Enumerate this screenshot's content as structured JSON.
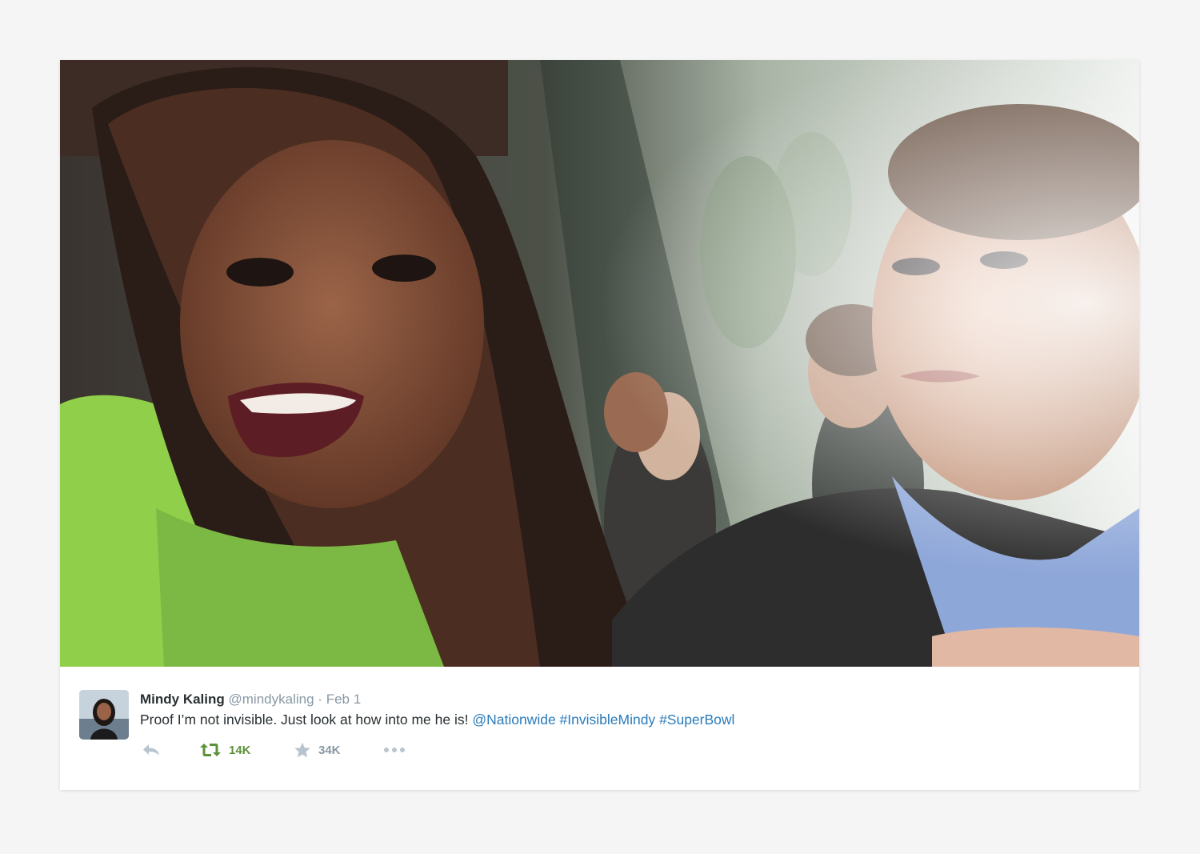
{
  "tweet": {
    "author_name": "Mindy Kaling",
    "handle": "@mindykaling",
    "separator": "·",
    "date": "Feb 1",
    "text_plain": "Proof I’m not invisible. Just look at how into me he is! ",
    "mentions": [
      "@Nationwide",
      "#InvisibleMindy",
      "#SuperBowl"
    ]
  },
  "actions": {
    "retweet_count": "14K",
    "favorite_count": "34K"
  },
  "icons": {
    "reply": "reply-icon",
    "retweet": "retweet-icon",
    "favorite": "star-icon",
    "more": "more-dots-icon"
  },
  "colors": {
    "page_background": "#f6f5f5",
    "card_background": "#ffffff",
    "text_primary": "#292f33",
    "text_secondary": "#8899a6",
    "link": "#2b7bb9",
    "retweet_active": "#5c913b"
  }
}
